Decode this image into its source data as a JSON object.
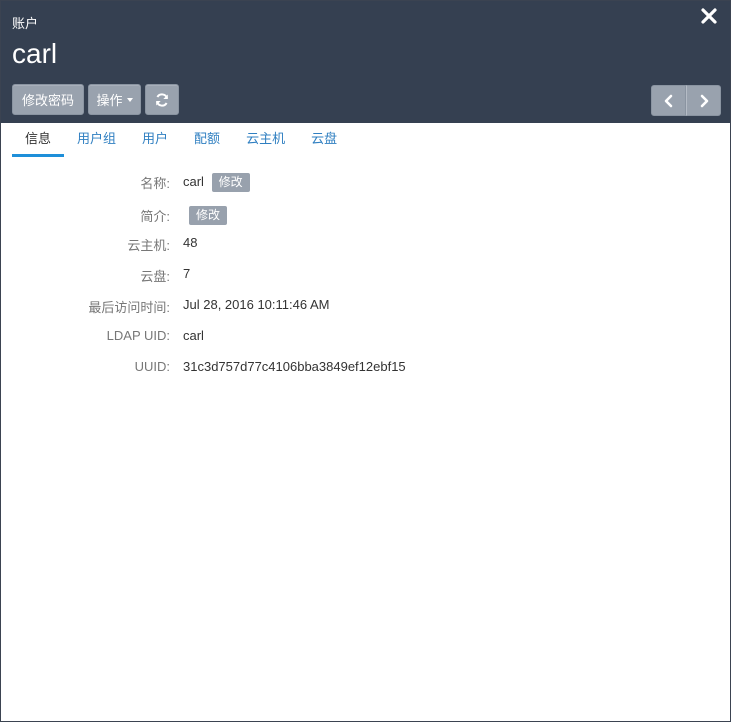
{
  "header": {
    "subtitle": "账户",
    "title": "carl",
    "close_icon": "close-icon"
  },
  "toolbar": {
    "change_password_label": "修改密码",
    "actions_label": "操作",
    "refresh_icon": "refresh-icon",
    "prev_icon": "chevron-left-icon",
    "next_icon": "chevron-right-icon"
  },
  "tabs": [
    {
      "label": "信息",
      "active": true
    },
    {
      "label": "用户组",
      "active": false
    },
    {
      "label": "用户",
      "active": false
    },
    {
      "label": "配额",
      "active": false
    },
    {
      "label": "云主机",
      "active": false
    },
    {
      "label": "云盘",
      "active": false
    }
  ],
  "details": {
    "name": {
      "label": "名称:",
      "value": "carl",
      "edit": "修改"
    },
    "description": {
      "label": "简介:",
      "edit": "修改"
    },
    "vm": {
      "label": "云主机:",
      "value": "48"
    },
    "volume": {
      "label": "云盘:",
      "value": "7"
    },
    "last_access": {
      "label": "最后访问时间:",
      "value": "Jul 28, 2016 10:11:46 AM"
    },
    "ldap_uid": {
      "label": "LDAP UID:",
      "value": "carl"
    },
    "uuid": {
      "label": "UUID:",
      "value": "31c3d757d77c4106bba3849ef12ebf15"
    }
  },
  "colors": {
    "header_bg": "#354051",
    "tab_link": "#2f7fc1",
    "tab_active_underline": "#1e8fd9",
    "button_bg": "#99a2ae"
  }
}
